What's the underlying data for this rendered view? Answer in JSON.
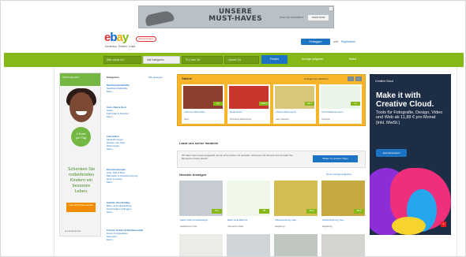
{
  "top_banner": {
    "title_line1": "UNSERE",
    "title_line2": "MUST-HAVES",
    "subtitle": "NIKE AIR VAPORMAX",
    "button": "SHOP NOW",
    "ad_mark": "x"
  },
  "header": {
    "logo_e": "e",
    "logo_b": "b",
    "logo_a": "a",
    "logo_y": "y",
    "badge": "Kleinanzeigen",
    "tagline": "Kostenlos. Einfach. Lokal.",
    "signin": "Einloggen",
    "or": "oder",
    "register": "Registrieren"
  },
  "search": {
    "query_placeholder": "Was suchst du?",
    "category": "Alle Kategorien",
    "zip_placeholder": "PLZ oder Ort",
    "radius": "Ganzer Ort",
    "find_button": "Finden",
    "post_ad": "Anzeige aufgeben",
    "my_ads": "Meine"
  },
  "left_ad": {
    "top_text": "SOS Kinderdorf",
    "amount": "1 Euro",
    "amount_sub": "pro Tag",
    "copy": "Schenken Sie notleidenden Kindern ein besseres Leben.",
    "button": "Jetzt SOS-Pate werden",
    "footer": "sos-kinderdorf.de"
  },
  "categories": {
    "title": "Kategorien",
    "all": "Alle anzeigen",
    "groups": [
      {
        "head": "Nachbarschaftshilfe",
        "items": [
          "Nachbarschaftshilfe",
          "Mehr..."
        ]
      },
      {
        "head": "Auto, Rad & Boot",
        "items": [
          "Autos",
          "Fahrräder & Zubehör",
          "Mehr..."
        ]
      },
      {
        "head": "Immobilien",
        "items": [
          "Mietwohnungen",
          "Häuser zum Kauf",
          "Wohnungen",
          "Mehr..."
        ]
      },
      {
        "head": "Dienstleistungen",
        "items": [
          "Auto, Rad & Boot",
          "Babysitter & Kinderbetreuung",
          "Haus & Garten",
          "Mehr..."
        ]
      },
      {
        "head": "Familie, Kind & Baby",
        "items": [
          "Baby- & Kinderkleidung",
          "Kinderwagen & Buggys",
          "Mehr..."
        ]
      },
      {
        "head": "Freizeit, Hobby & Nachbarschaft",
        "items": [
          "Kunst & Antiquitäten",
          "Sammeln",
          "Mehr..."
        ]
      }
    ]
  },
  "gallery": {
    "title": "Galerie",
    "link": "Anzeige hier platzieren",
    "left_arrow": "‹",
    "right_arrow": "›",
    "cards": [
      {
        "name": "4 Zimmer Altbau Woh...",
        "city": "Aiken",
        "price": "1 €"
      },
      {
        "name": "Smart fortwo",
        "city": "Schönberg Mecklenburg",
        "price": "4.500 €"
      },
      {
        "name": "3-Raum-Wohnung Ni...",
        "city": "Garz (Usedom)",
        "price": "350 €"
      },
      {
        "name": "GUTSCHEIN für einen...",
        "city": "Grünwald",
        "price": "1 €"
      }
    ]
  },
  "safety": {
    "title": "Lasst uns sicher handeln!",
    "text": "Wir haben Tipps zusammengestellt, wie Sie sicher kaufen und verkaufen. Informieren Sie sich jetzt und vermeiden Sie Betrug beim Online-Handel.",
    "button": "Weiter zu unseren Tipps"
  },
  "new_ads": {
    "title": "Neueste Anzeigen",
    "link": "Neue Anzeige aufgeben",
    "cards": [
      {
        "name": "Glaser UHG Grundstueckgeh...",
        "city": "Staatsforsten Hütte",
        "price": "10 €"
      },
      {
        "name": "Maier vonta Möbl ani",
        "city": "Obervallner Mühle",
        "price": "VB"
      },
      {
        "name": "3-Raumwohnung, Nen...",
        "city": "Magdeburg",
        "price": "350 €"
      },
      {
        "name": "3-Raumwohnung, Nen...",
        "city": "Magdeburg",
        "price": "350 €"
      }
    ]
  },
  "right_ad": {
    "logo": "Creative Cloud",
    "heading": "Make it with Creative Cloud.",
    "copy": "Tools für Fotografie, Design, Video und Web ab 11,89 € pro Monat (inkl. MwSt.)",
    "button": "Jetzt abonnieren",
    "mark": "A"
  }
}
